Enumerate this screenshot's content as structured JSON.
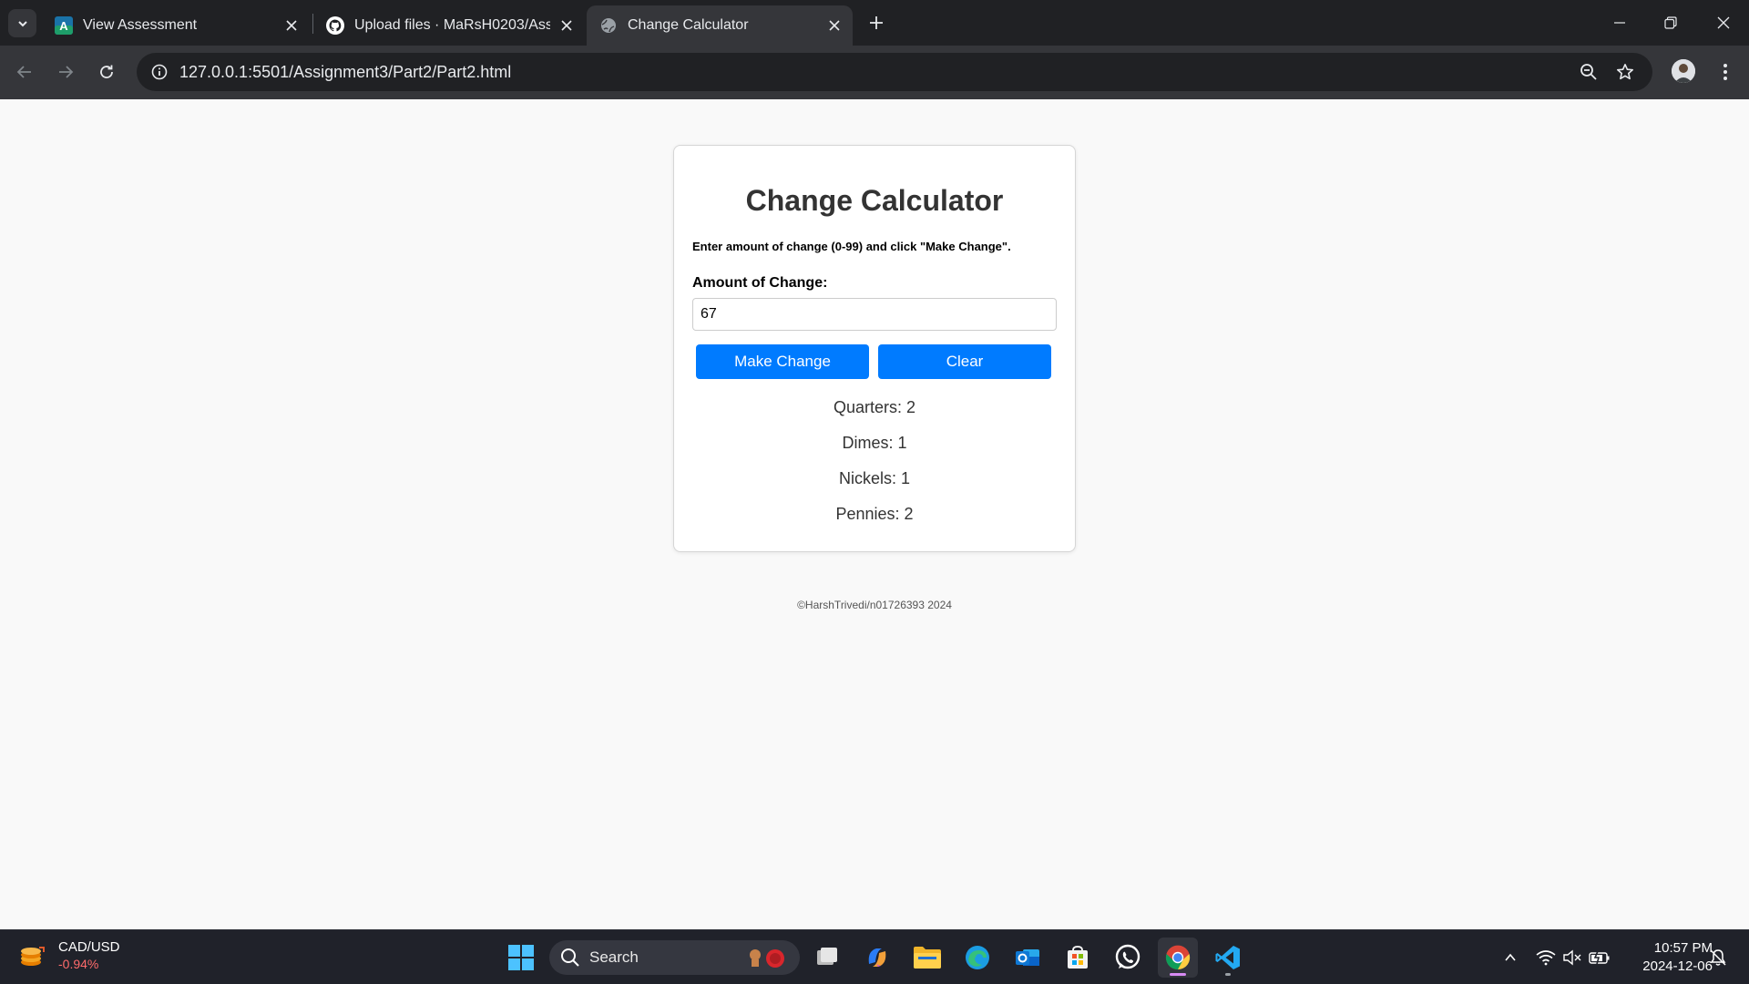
{
  "browser": {
    "tabs": [
      {
        "title": "View Assessment",
        "icon": "assessment-favicon"
      },
      {
        "title": "Upload files · MaRsH0203/Assig",
        "icon": "github-icon"
      },
      {
        "title": "Change Calculator",
        "icon": "globe-icon"
      }
    ],
    "url": "127.0.0.1:5501/Assignment3/Part2/Part2.html"
  },
  "page": {
    "title": "Change Calculator",
    "instructions": "Enter amount of change (0-99) and click \"Make Change\".",
    "amount_label": "Amount of Change:",
    "amount_value": "67",
    "make_change_label": "Make Change",
    "clear_label": "Clear",
    "results": {
      "quarters": "Quarters: 2",
      "dimes": "Dimes: 1",
      "nickels": "Nickels: 1",
      "pennies": "Pennies: 2"
    },
    "footer": "©HarshTrivedi/n01726393 2024",
    "button_color": "#007bff"
  },
  "taskbar": {
    "widget_title": "CAD/USD",
    "widget_change": "-0.94%",
    "search_label": "Search",
    "time": "10:57 PM",
    "date": "2024-12-06"
  }
}
